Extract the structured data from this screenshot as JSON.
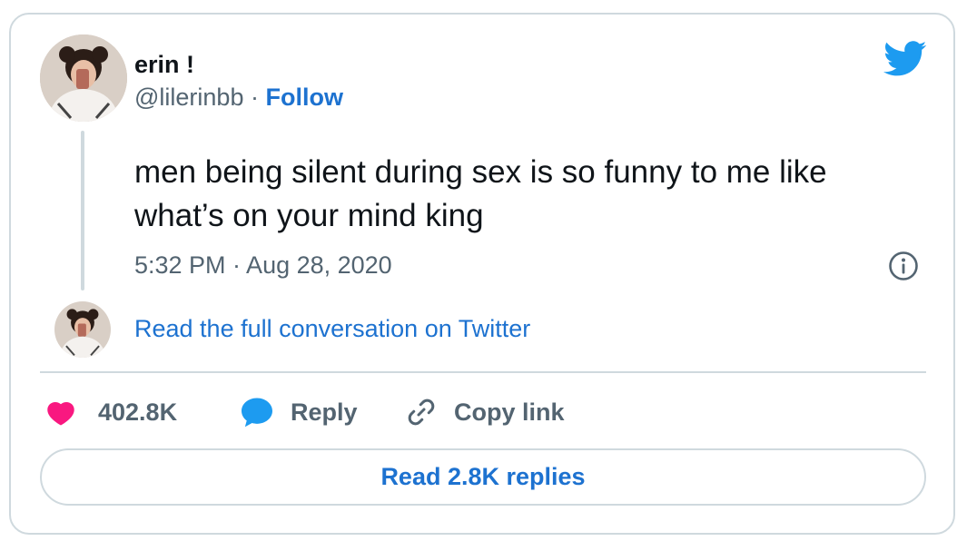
{
  "tweet": {
    "author_name": "erin !",
    "handle": "@lilerinbb",
    "separator": "·",
    "follow_label": "Follow",
    "text": "men being silent during sex is so funny to me like what’s on your mind king",
    "timestamp": "5:32 PM · Aug 28, 2020",
    "read_conversation_label": "Read the full conversation on Twitter"
  },
  "actions": {
    "likes_count": "402.8K",
    "reply_label": "Reply",
    "copy_link_label": "Copy link",
    "read_replies_label": "Read 2.8K replies"
  },
  "icons": {
    "brand": "twitter-bird-icon",
    "like": "heart-icon",
    "reply": "reply-bubble-icon",
    "copy": "link-icon",
    "info": "info-icon"
  },
  "colors": {
    "twitter_blue": "#1d9bf0",
    "link_blue": "#1d72d0",
    "like_pink": "#f91880",
    "muted_gray": "#536471",
    "border_gray": "#cfd9de"
  }
}
